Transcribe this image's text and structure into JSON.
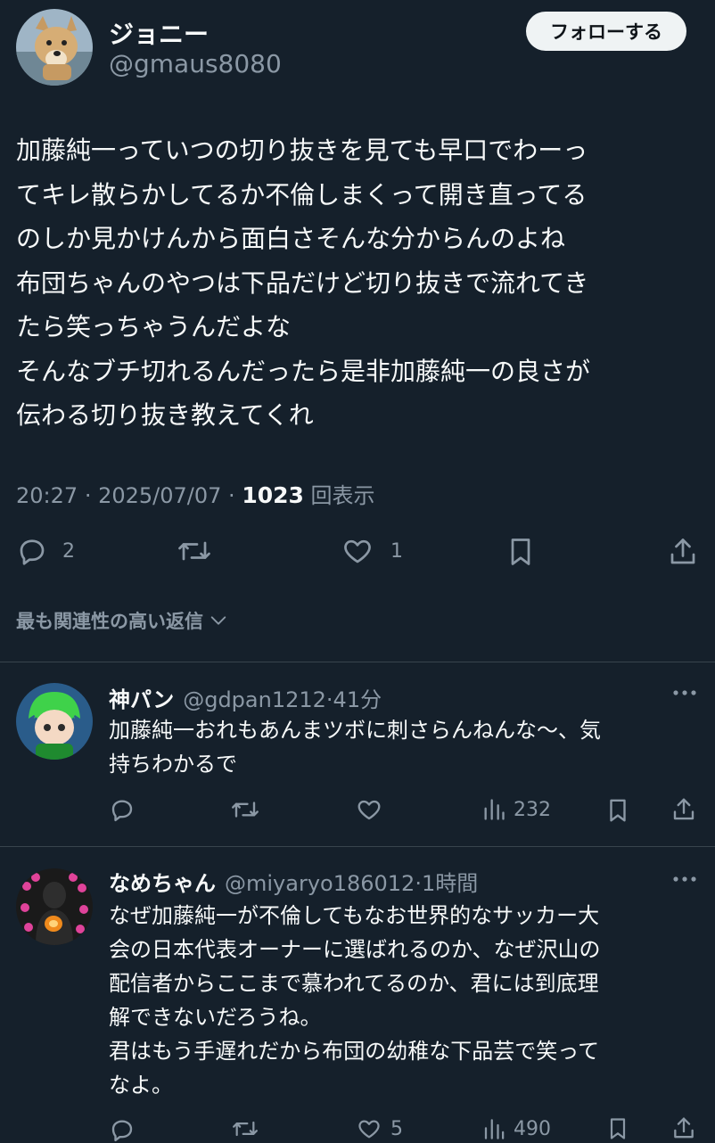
{
  "tweet": {
    "author": {
      "name": "ジョニー",
      "handle": "@gmaus8080"
    },
    "follow_label": "フォローする",
    "body_lines": [
      "加藤純一っていつの切り抜きを見ても早口でわーっ",
      "てキレ散らかしてるか不倫しまくって開き直ってる",
      "のしか見かけんから面白さそんな分からんのよね",
      "布団ちゃんのやつは下品だけど切り抜きで流れてき",
      "たら笑っちゃうんだよな",
      "そんなブチ切れるんだったら是非加藤純一の良さが",
      "伝わる切り抜き教えてくれ"
    ],
    "time": "20:27",
    "date": "2025/07/07",
    "views": "1023",
    "views_label": "回表示",
    "actions": {
      "reply_count": "2",
      "like_count": "1"
    }
  },
  "sort_label": "最も関連性の高い返信",
  "replies": [
    {
      "name": "神パン",
      "handle": "@gdpan1212",
      "time": "41分",
      "lines": [
        "加藤純一おれもあんまツボに刺さらんねんな〜、気",
        "持ちわかるで"
      ],
      "like_count": "",
      "views": "232"
    },
    {
      "name": "なめちゃん",
      "handle": "@miyaryo186012",
      "time": "1時間",
      "lines": [
        "なぜ加藤純一が不倫してもなお世界的なサッカー大",
        "会の日本代表オーナーに選ばれるのか、なぜ沢山の",
        "配信者からここまで慕われてるのか、君には到底理",
        "解できないだろうね。",
        "君はもう手遅れだから布団の幼稚な下品芸で笑って",
        "なよ。"
      ],
      "like_count": "5",
      "views": "490"
    }
  ],
  "icons": [
    "reply-icon",
    "retweet-icon",
    "like-icon",
    "bookmark-icon",
    "share-icon",
    "views-icon",
    "more-icon",
    "chevron-down-icon"
  ],
  "colors": {
    "background": "#15202b",
    "text": "#f7f9f9",
    "muted": "#8b98a5",
    "divider": "#38444d",
    "follow_bg": "#eff3f4"
  }
}
